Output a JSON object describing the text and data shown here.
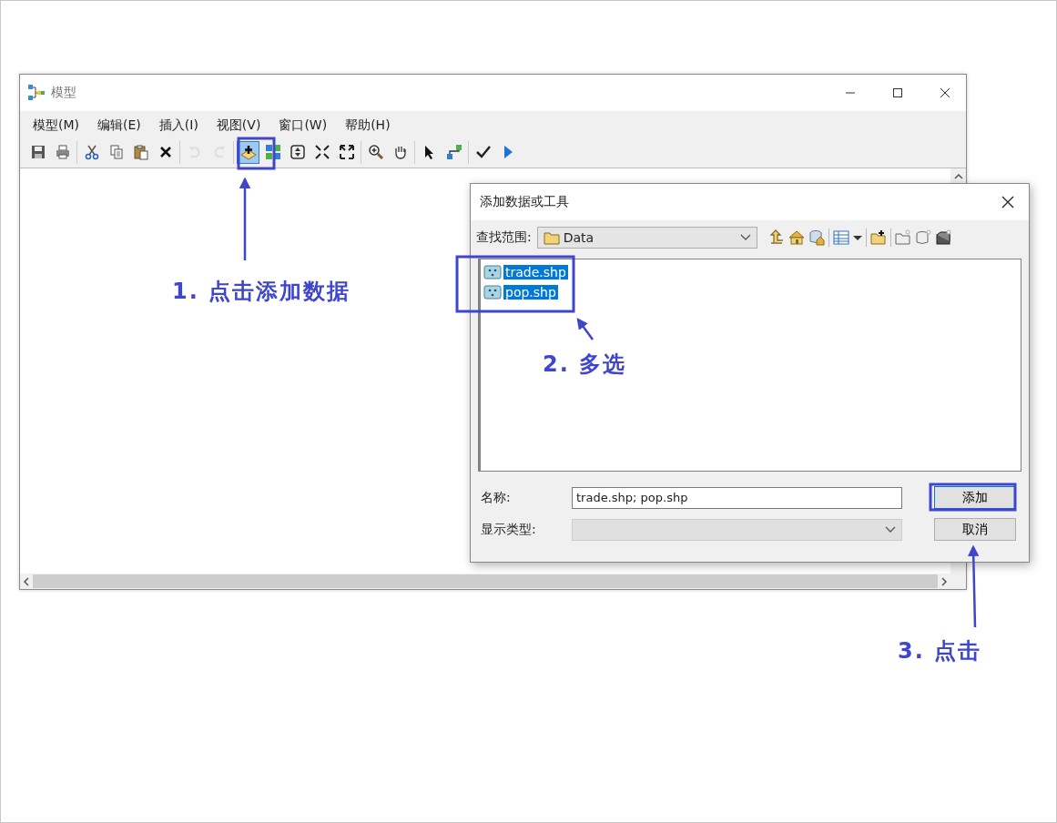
{
  "window": {
    "title": "模型"
  },
  "menu": [
    "模型(M)",
    "编辑(E)",
    "插入(I)",
    "视图(V)",
    "窗口(W)",
    "帮助(H)"
  ],
  "toolbar_groups": [
    [
      {
        "kind": "save",
        "disabled": false,
        "highlighted": false
      },
      {
        "kind": "print",
        "disabled": false,
        "highlighted": false
      }
    ],
    [
      {
        "kind": "cut",
        "disabled": false,
        "highlighted": false
      },
      {
        "kind": "copy",
        "disabled": false,
        "highlighted": false
      },
      {
        "kind": "paste",
        "disabled": false,
        "highlighted": false
      },
      {
        "kind": "delete",
        "disabled": false,
        "highlighted": false
      }
    ],
    [
      {
        "kind": "undo",
        "disabled": true,
        "highlighted": false
      },
      {
        "kind": "redo",
        "disabled": true,
        "highlighted": false
      }
    ],
    [
      {
        "kind": "add",
        "disabled": false,
        "highlighted": true
      },
      {
        "kind": "layout",
        "disabled": false,
        "highlighted": false
      },
      {
        "kind": "extent",
        "disabled": false,
        "highlighted": false
      },
      {
        "kind": "shrink",
        "disabled": false,
        "highlighted": false
      },
      {
        "kind": "expand",
        "disabled": false,
        "highlighted": false
      }
    ],
    [
      {
        "kind": "zoom",
        "disabled": false,
        "highlighted": false
      },
      {
        "kind": "pan",
        "disabled": false,
        "highlighted": false
      }
    ],
    [
      {
        "kind": "select",
        "disabled": false,
        "highlighted": false
      },
      {
        "kind": "connect",
        "disabled": false,
        "highlighted": false
      }
    ],
    [
      {
        "kind": "validate",
        "disabled": false,
        "highlighted": false
      },
      {
        "kind": "run",
        "disabled": false,
        "highlighted": false
      }
    ]
  ],
  "dialog": {
    "title": "添加数据或工具",
    "look_in_label": "查找范围:",
    "location": "Data",
    "files": [
      {
        "name": "trade.shp",
        "selected": true
      },
      {
        "name": "pop.shp",
        "selected": true
      }
    ],
    "name_label": "名称:",
    "name_value": "trade.shp; pop.shp",
    "type_label": "显示类型:",
    "buttons": [
      "添加",
      "取消"
    ]
  },
  "annotations": [
    {
      "text": "1. 点击添加数据"
    },
    {
      "text": "2. 多选"
    },
    {
      "text": "3. 点击"
    }
  ]
}
